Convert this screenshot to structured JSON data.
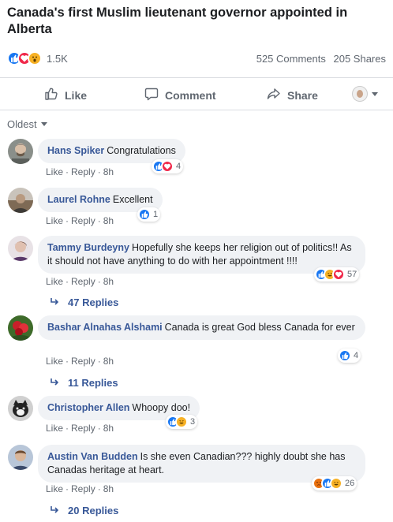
{
  "post": {
    "headline": "Canada's first Muslim lieutenant governor appointed in Alberta",
    "reaction_count": "1.5K",
    "comments_count": "525 Comments",
    "shares_count": "205 Shares"
  },
  "actions": {
    "like": "Like",
    "comment": "Comment",
    "share": "Share"
  },
  "sort_label": "Oldest",
  "meta_labels": {
    "like": "Like",
    "reply": "Reply"
  },
  "comments": [
    {
      "name": "Hans Spiker",
      "text": "Congratulations",
      "time": "8h",
      "reactions_count": "4"
    },
    {
      "name": "Laurel Rohne",
      "text": "Excellent",
      "time": "8h",
      "reactions_count": "1"
    },
    {
      "name": "Tammy Burdeyny",
      "text": "Hopefully she keeps her religion out of politics!! As it should not have anything to do with her appointment !!!!",
      "time": "8h",
      "reactions_count": "57",
      "replies": "47 Replies"
    },
    {
      "name": "Bashar Alnahas Alshami",
      "text": "Canada is great God bless Canada for ever",
      "time": "8h",
      "reactions_count": "4",
      "replies": "11 Replies"
    },
    {
      "name": "Christopher Allen",
      "text": "Whoopy doo!",
      "time": "8h",
      "reactions_count": "3"
    },
    {
      "name": "Austin Van Budden",
      "text": "Is she even Canadian??? highly doubt she has Canadas heritage at heart.",
      "time": "8h",
      "reactions_count": "26",
      "replies": "20 Replies"
    }
  ],
  "colors": {
    "name_link": "#385898",
    "like_blue": "#1877f2",
    "love_red": "#f0284a",
    "wow_yellow": "#f7b125",
    "angry_orange": "#e9710f"
  }
}
